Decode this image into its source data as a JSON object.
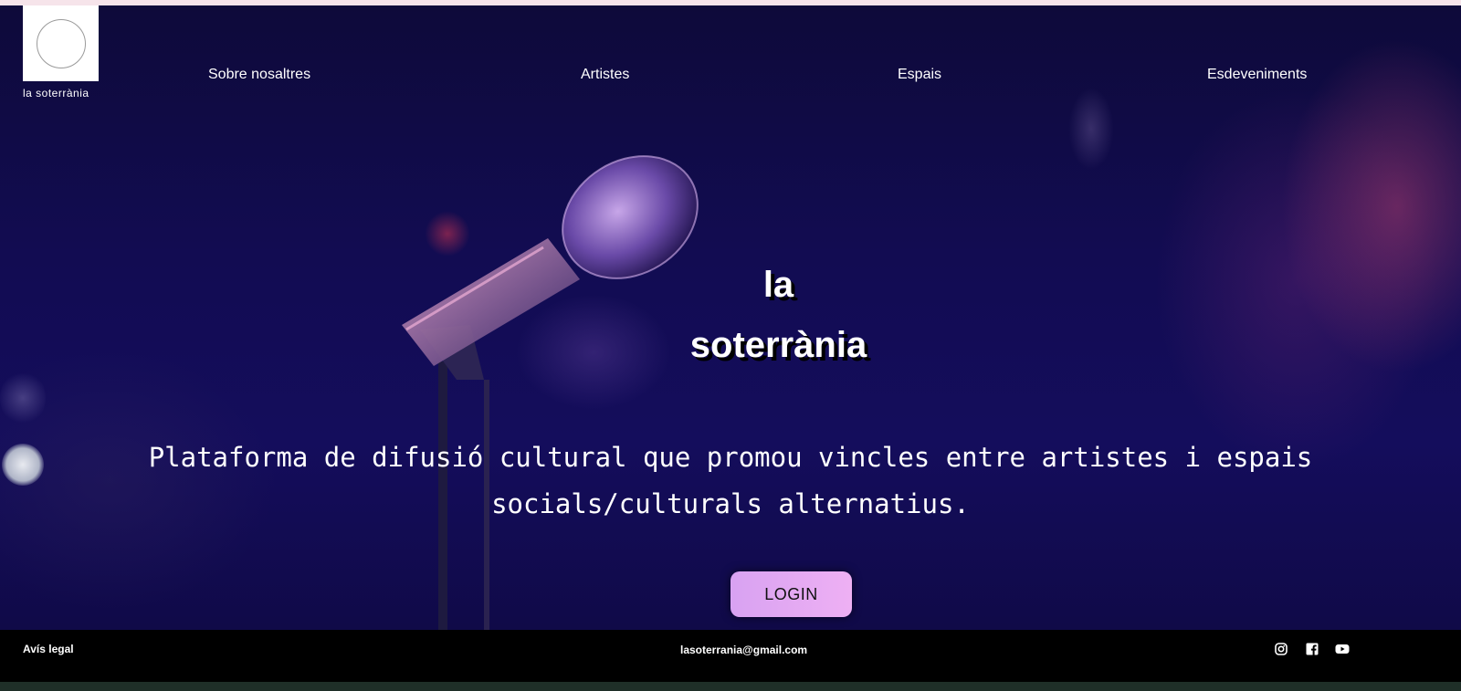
{
  "logo": {
    "text": "la soterrània"
  },
  "nav": {
    "items": [
      {
        "label": "Sobre nosaltres"
      },
      {
        "label": "Artistes"
      },
      {
        "label": "Espais"
      },
      {
        "label": "Esdeveniments"
      }
    ]
  },
  "hero": {
    "title_line1": "la",
    "title_line2": "soterrània",
    "tagline_line1": "Plataforma de difusió cultural que promou vincles entre artistes i espais",
    "tagline_line2": "socials/culturals alternatius.",
    "login_label": "LOGIN"
  },
  "footer": {
    "legal": "Avís legal",
    "email": "lasoterrania@gmail.com",
    "social_icons": [
      "instagram-icon",
      "facebook-icon",
      "youtube-icon"
    ]
  },
  "colors": {
    "hero_bg": "#130c55",
    "login_bg": "#e4aaf3",
    "footer_bg": "#000000"
  }
}
